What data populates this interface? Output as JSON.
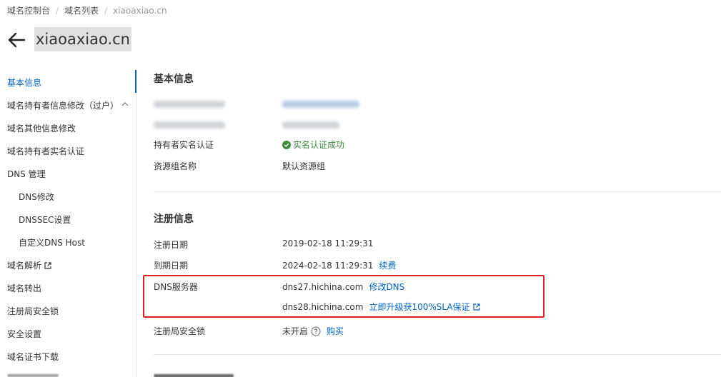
{
  "breadcrumb": {
    "items": [
      "域名控制台",
      "域名列表"
    ],
    "current": "xiaoaxiao.cn"
  },
  "header": {
    "title": "xiaoaxiao.cn"
  },
  "sidebar": {
    "items": [
      {
        "label": "基本信息"
      },
      {
        "label": "域名持有者信息修改（过户）"
      },
      {
        "label": "域名其他信息修改"
      },
      {
        "label": "域名持有者实名认证"
      },
      {
        "label": "DNS 管理"
      },
      {
        "label": "DNS修改"
      },
      {
        "label": "DNSSEC设置"
      },
      {
        "label": "自定义DNS Host"
      },
      {
        "label": "域名解析"
      },
      {
        "label": "域名转出"
      },
      {
        "label": "注册局安全锁"
      },
      {
        "label": "安全设置"
      },
      {
        "label": "域名证书下载"
      }
    ]
  },
  "basic": {
    "title": "基本信息",
    "realname_label": "持有者实名认证",
    "realname_value": "实名认证成功",
    "group_label": "资源组名称",
    "group_value": "默认资源组"
  },
  "registration": {
    "title": "注册信息",
    "reg_date_label": "注册日期",
    "reg_date_value": "2019-02-18 11:29:31",
    "exp_date_label": "到期日期",
    "exp_date_value": "2024-02-18 11:29:31",
    "renew_link": "续费",
    "dns_label": "DNS服务器",
    "dns1": "dns27.hichina.com",
    "modify_dns_link": "修改DNS",
    "dns2": "dns28.hichina.com",
    "upgrade_link": "立即升级获100%SLA保证",
    "lock_label": "注册局安全锁",
    "lock_value": "未开启",
    "buy_link": "购买"
  },
  "colors": {
    "accent": "#0064c8",
    "success": "#3a8a3a",
    "highlight": "#e02020"
  }
}
